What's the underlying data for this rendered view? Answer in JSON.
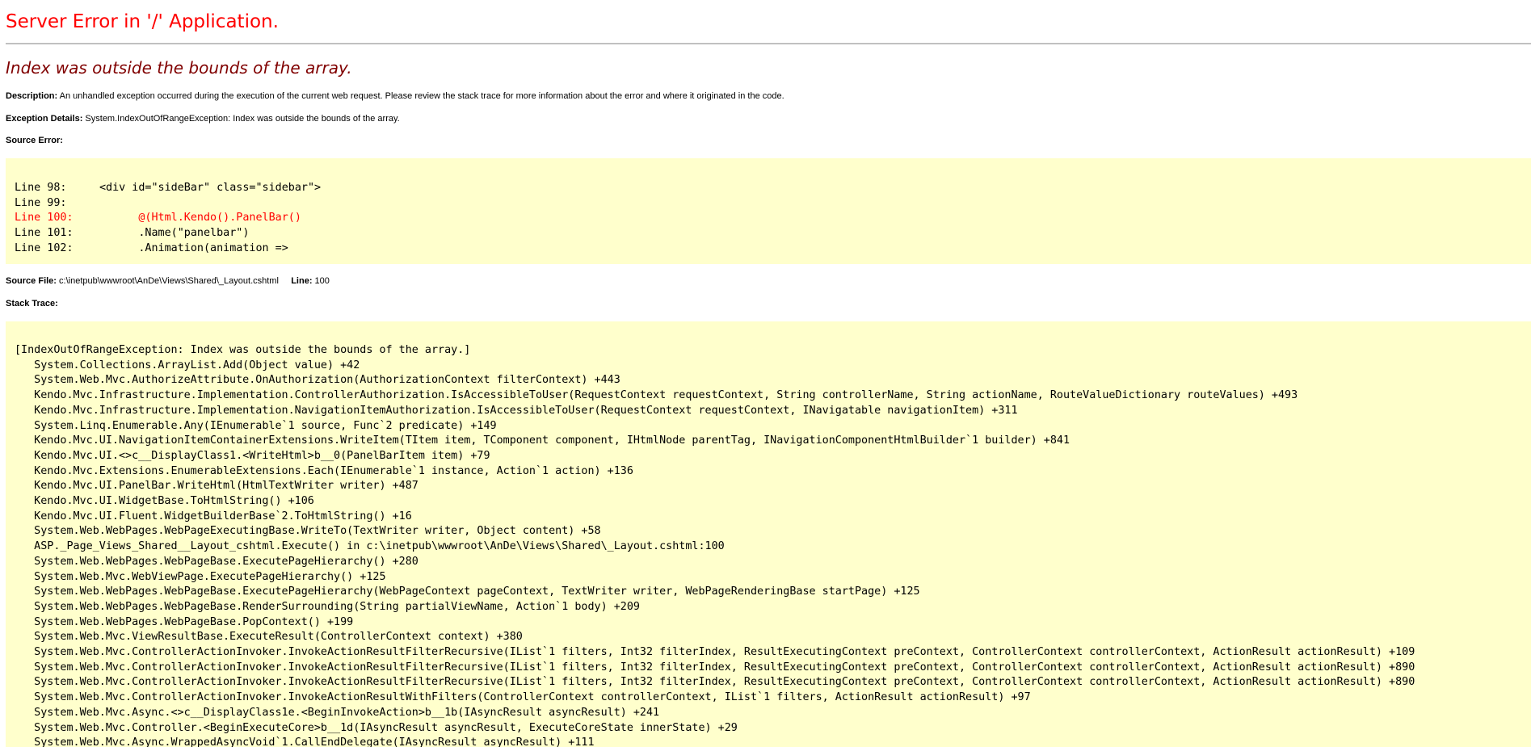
{
  "header": {
    "title": "Server Error in '/' Application.",
    "subtitle": "Index was outside the bounds of the array."
  },
  "description": {
    "label": "Description:",
    "text": "An unhandled exception occurred during the execution of the current web request. Please review the stack trace for more information about the error and where it originated in the code."
  },
  "exception_details": {
    "label": "Exception Details:",
    "text": "System.IndexOutOfRangeException: Index was outside the bounds of the array."
  },
  "source_error": {
    "label": "Source Error:",
    "lines": [
      {
        "number": "Line 98:",
        "code": "<div id=\"sideBar\" class=\"sidebar\">",
        "is_error": false
      },
      {
        "number": "Line 99:",
        "code": "",
        "is_error": false
      },
      {
        "number": "Line 100:",
        "code": "      @(Html.Kendo().PanelBar()",
        "is_error": true
      },
      {
        "number": "Line 101:",
        "code": "      .Name(\"panelbar\")",
        "is_error": false
      },
      {
        "number": "Line 102:",
        "code": "      .Animation(animation =>",
        "is_error": false
      }
    ]
  },
  "source_file": {
    "label": "Source File:",
    "path": "c:\\inetpub\\wwwroot\\AnDe\\Views\\Shared\\_Layout.cshtml",
    "line_label": "Line:",
    "line_number": "100"
  },
  "stack_trace": {
    "label": "Stack Trace:",
    "lines": [
      "[IndexOutOfRangeException: Index was outside the bounds of the array.]",
      "   System.Collections.ArrayList.Add(Object value) +42",
      "   System.Web.Mvc.AuthorizeAttribute.OnAuthorization(AuthorizationContext filterContext) +443",
      "   Kendo.Mvc.Infrastructure.Implementation.ControllerAuthorization.IsAccessibleToUser(RequestContext requestContext, String controllerName, String actionName, RouteValueDictionary routeValues) +493",
      "   Kendo.Mvc.Infrastructure.Implementation.NavigationItemAuthorization.IsAccessibleToUser(RequestContext requestContext, INavigatable navigationItem) +311",
      "   System.Linq.Enumerable.Any(IEnumerable`1 source, Func`2 predicate) +149",
      "   Kendo.Mvc.UI.NavigationItemContainerExtensions.WriteItem(TItem item, TComponent component, IHtmlNode parentTag, INavigationComponentHtmlBuilder`1 builder) +841",
      "   Kendo.Mvc.UI.<>c__DisplayClass1.<WriteHtml>b__0(PanelBarItem item) +79",
      "   Kendo.Mvc.Extensions.EnumerableExtensions.Each(IEnumerable`1 instance, Action`1 action) +136",
      "   Kendo.Mvc.UI.PanelBar.WriteHtml(HtmlTextWriter writer) +487",
      "   Kendo.Mvc.UI.WidgetBase.ToHtmlString() +106",
      "   Kendo.Mvc.UI.Fluent.WidgetBuilderBase`2.ToHtmlString() +16",
      "   System.Web.WebPages.WebPageExecutingBase.WriteTo(TextWriter writer, Object content) +58",
      "   ASP._Page_Views_Shared__Layout_cshtml.Execute() in c:\\inetpub\\wwwroot\\AnDe\\Views\\Shared\\_Layout.cshtml:100",
      "   System.Web.WebPages.WebPageBase.ExecutePageHierarchy() +280",
      "   System.Web.Mvc.WebViewPage.ExecutePageHierarchy() +125",
      "   System.Web.WebPages.WebPageBase.ExecutePageHierarchy(WebPageContext pageContext, TextWriter writer, WebPageRenderingBase startPage) +125",
      "   System.Web.WebPages.WebPageBase.RenderSurrounding(String partialViewName, Action`1 body) +209",
      "   System.Web.WebPages.WebPageBase.PopContext() +199",
      "   System.Web.Mvc.ViewResultBase.ExecuteResult(ControllerContext context) +380",
      "   System.Web.Mvc.ControllerActionInvoker.InvokeActionResultFilterRecursive(IList`1 filters, Int32 filterIndex, ResultExecutingContext preContext, ControllerContext controllerContext, ActionResult actionResult) +109",
      "   System.Web.Mvc.ControllerActionInvoker.InvokeActionResultFilterRecursive(IList`1 filters, Int32 filterIndex, ResultExecutingContext preContext, ControllerContext controllerContext, ActionResult actionResult) +890",
      "   System.Web.Mvc.ControllerActionInvoker.InvokeActionResultFilterRecursive(IList`1 filters, Int32 filterIndex, ResultExecutingContext preContext, ControllerContext controllerContext, ActionResult actionResult) +890",
      "   System.Web.Mvc.ControllerActionInvoker.InvokeActionResultWithFilters(ControllerContext controllerContext, IList`1 filters, ActionResult actionResult) +97",
      "   System.Web.Mvc.Async.<>c__DisplayClass1e.<BeginInvokeAction>b__1b(IAsyncResult asyncResult) +241",
      "   System.Web.Mvc.Controller.<BeginExecuteCore>b__1d(IAsyncResult asyncResult, ExecuteCoreState innerState) +29",
      "   System.Web.Mvc.Async.WrappedAsyncVoid`1.CallEndDelegate(IAsyncResult asyncResult) +111"
    ]
  },
  "colors": {
    "title": "#ff0000",
    "subtitle": "#800000",
    "code_background": "#ffffcc",
    "error_line": "#ff0000",
    "rule": "#c0c0c0"
  }
}
